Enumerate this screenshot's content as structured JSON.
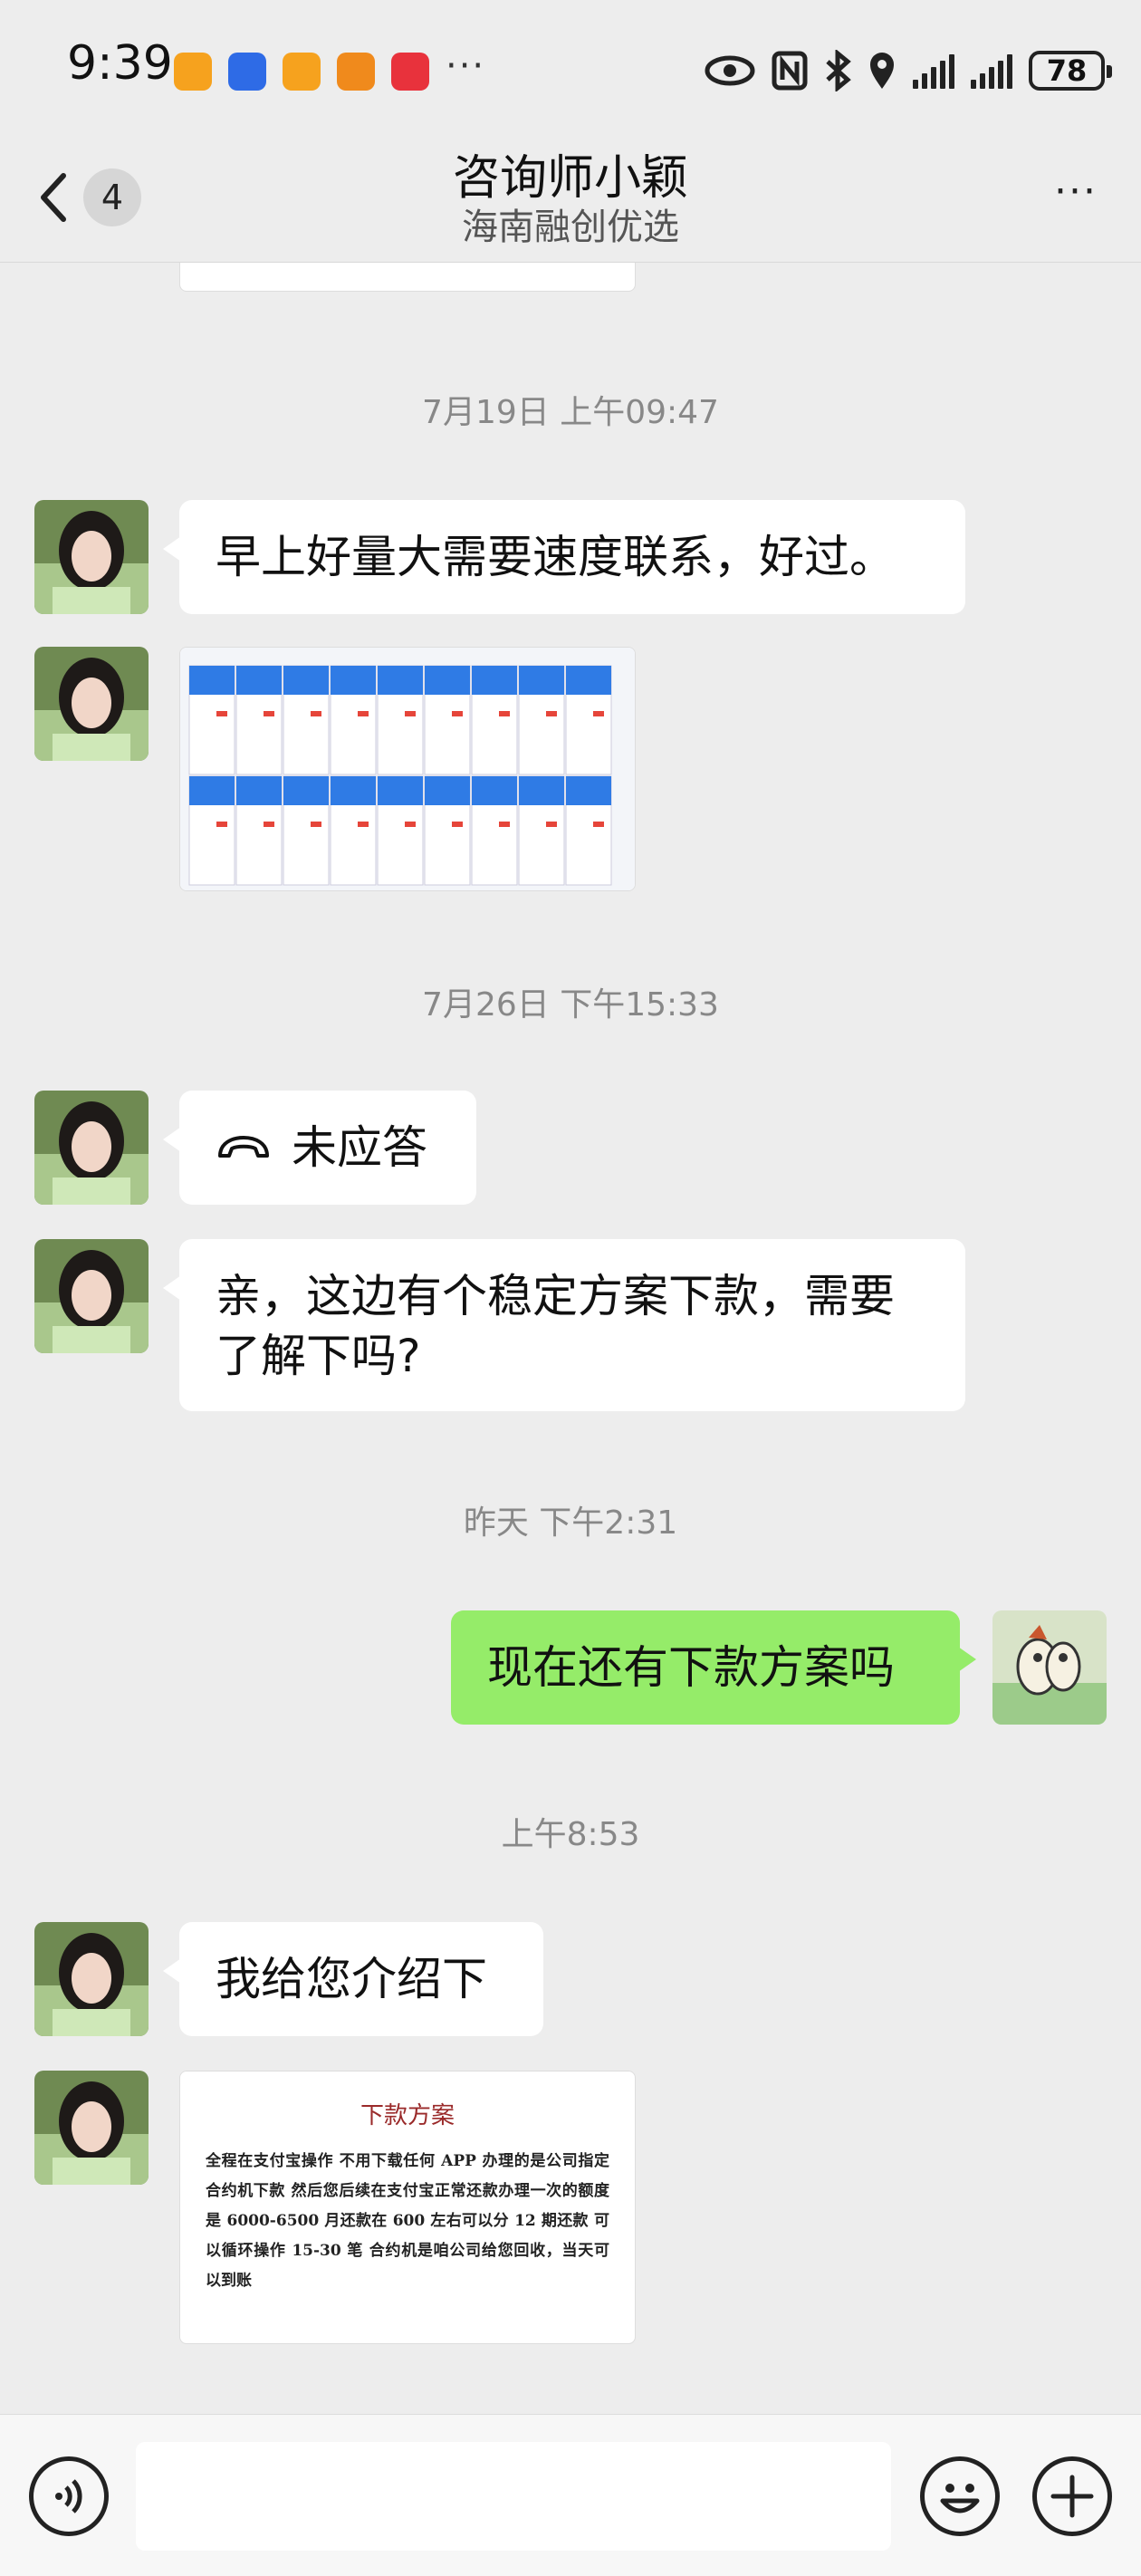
{
  "status_bar": {
    "time": "9:39",
    "battery": "78",
    "more": "···"
  },
  "header": {
    "back_badge": "4",
    "title": "咨询师小颖",
    "subtitle": "海南融创优选",
    "menu": "···"
  },
  "messages": {
    "ts1": "7月19日 上午09:47",
    "m1": "早上好量大需要速度联系，好过。",
    "ts2": "7月26日 下午15:33",
    "call_text": "未应答",
    "m3": "亲，这边有个稳定方案下款，需要了解下吗?",
    "ts3": "昨天 下午2:31",
    "m4": "现在还有下款方案吗",
    "ts4": "上午8:53",
    "m5": "我给您介绍下",
    "doc": {
      "title": "下款方案",
      "body": "全程在支付宝操作 不用下载任何 APP 办理的是公司指定合约机下款 然后您后续在支付宝正常还款办理一次的额度是 6000-6500 月还款在 600 左右可以分 12 期还款 可以循环操作 15-30 笔 合约机是咱公司给您回收，当天可以到账"
    }
  },
  "colors": {
    "background": "#ededed",
    "bubble_self": "#95ec69",
    "bubble_other": "#ffffff",
    "doc_title": "#9a2a2a"
  },
  "icons": [
    "back-chevron-icon",
    "more-icon",
    "voice-icon",
    "emoji-icon",
    "plus-icon",
    "missed-call-icon"
  ]
}
